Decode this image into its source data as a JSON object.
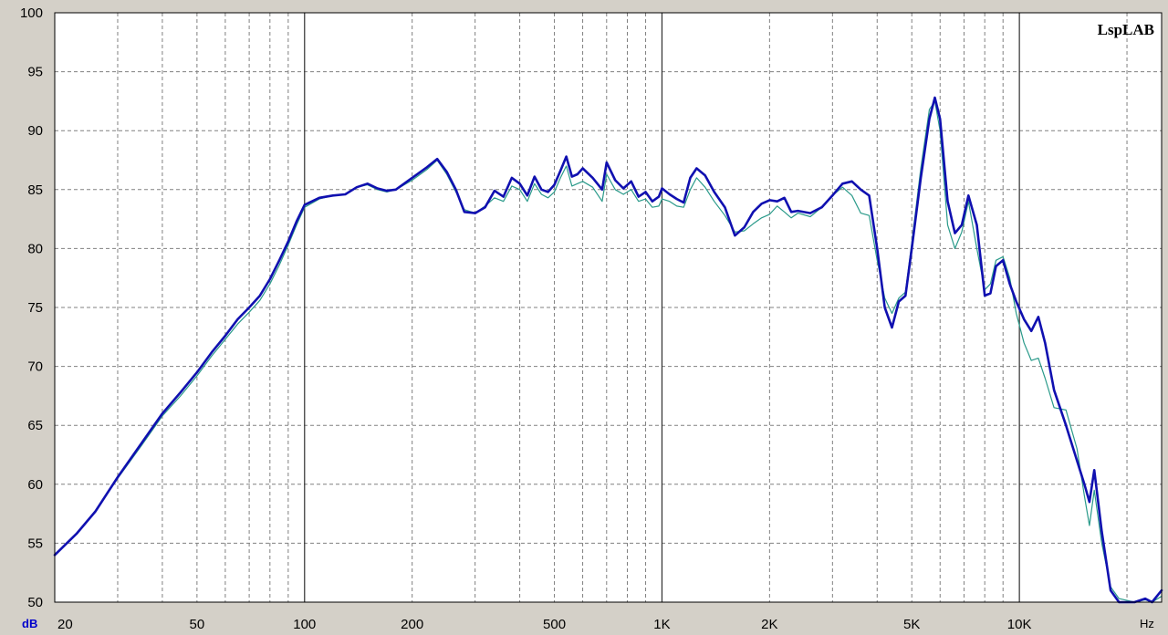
{
  "chart_data": {
    "type": "line",
    "title": "",
    "brand": "LspLAB",
    "xlabel": "Hz",
    "ylabel": "dB",
    "x_scale": "log",
    "xlim": [
      20,
      25000
    ],
    "ylim": [
      50,
      100
    ],
    "x_tick_labels": [
      {
        "value": 20,
        "label": "20"
      },
      {
        "value": 50,
        "label": "50"
      },
      {
        "value": 100,
        "label": "100"
      },
      {
        "value": 200,
        "label": "200"
      },
      {
        "value": 500,
        "label": "500"
      },
      {
        "value": 1000,
        "label": "1K"
      },
      {
        "value": 2000,
        "label": "2K"
      },
      {
        "value": 5000,
        "label": "5K"
      },
      {
        "value": 10000,
        "label": "10K"
      }
    ],
    "y_ticks": [
      50,
      55,
      60,
      65,
      70,
      75,
      80,
      85,
      90,
      95,
      100
    ],
    "grid": true,
    "legend": "none",
    "colors": {
      "plot_background": "#ffffff",
      "window_background": "#d4d0c8",
      "grid": "#808080",
      "axis_label": "#0000cc",
      "series_primary": "#1010b0",
      "series_secondary": "#2a9a8a"
    },
    "series": [
      {
        "color": "#1010b0",
        "points": [
          [
            20,
            54.0
          ],
          [
            23,
            55.8
          ],
          [
            26,
            57.7
          ],
          [
            30,
            60.6
          ],
          [
            35,
            63.5
          ],
          [
            40,
            66.0
          ],
          [
            45,
            67.8
          ],
          [
            50,
            69.5
          ],
          [
            55,
            71.2
          ],
          [
            60,
            72.6
          ],
          [
            65,
            74.0
          ],
          [
            70,
            75.0
          ],
          [
            75,
            76.0
          ],
          [
            80,
            77.4
          ],
          [
            85,
            79.0
          ],
          [
            90,
            80.6
          ],
          [
            95,
            82.3
          ],
          [
            100,
            83.7
          ],
          [
            110,
            84.3
          ],
          [
            120,
            84.5
          ],
          [
            130,
            84.6
          ],
          [
            140,
            85.2
          ],
          [
            150,
            85.5
          ],
          [
            160,
            85.1
          ],
          [
            170,
            84.9
          ],
          [
            180,
            85.0
          ],
          [
            200,
            86.0
          ],
          [
            220,
            86.9
          ],
          [
            235,
            87.6
          ],
          [
            250,
            86.5
          ],
          [
            265,
            85.0
          ],
          [
            280,
            83.1
          ],
          [
            300,
            83.0
          ],
          [
            320,
            83.5
          ],
          [
            340,
            84.9
          ],
          [
            360,
            84.4
          ],
          [
            380,
            86.0
          ],
          [
            400,
            85.5
          ],
          [
            420,
            84.5
          ],
          [
            440,
            86.1
          ],
          [
            460,
            85.0
          ],
          [
            480,
            84.8
          ],
          [
            500,
            85.4
          ],
          [
            520,
            86.6
          ],
          [
            540,
            87.8
          ],
          [
            560,
            86.1
          ],
          [
            580,
            86.3
          ],
          [
            600,
            86.8
          ],
          [
            640,
            86.0
          ],
          [
            680,
            85.0
          ],
          [
            700,
            87.3
          ],
          [
            740,
            85.8
          ],
          [
            780,
            85.1
          ],
          [
            820,
            85.7
          ],
          [
            860,
            84.4
          ],
          [
            900,
            84.8
          ],
          [
            940,
            84.0
          ],
          [
            980,
            84.4
          ],
          [
            1000,
            85.1
          ],
          [
            1050,
            84.6
          ],
          [
            1100,
            84.2
          ],
          [
            1150,
            83.9
          ],
          [
            1200,
            86.0
          ],
          [
            1250,
            86.8
          ],
          [
            1320,
            86.2
          ],
          [
            1400,
            84.8
          ],
          [
            1500,
            83.5
          ],
          [
            1600,
            81.1
          ],
          [
            1700,
            81.8
          ],
          [
            1800,
            83.1
          ],
          [
            1900,
            83.8
          ],
          [
            2000,
            84.1
          ],
          [
            2100,
            84.0
          ],
          [
            2200,
            84.3
          ],
          [
            2300,
            83.1
          ],
          [
            2400,
            83.2
          ],
          [
            2600,
            83.0
          ],
          [
            2800,
            83.5
          ],
          [
            3000,
            84.5
          ],
          [
            3200,
            85.5
          ],
          [
            3400,
            85.7
          ],
          [
            3600,
            85.0
          ],
          [
            3800,
            84.5
          ],
          [
            4000,
            80.0
          ],
          [
            4200,
            75.0
          ],
          [
            4400,
            73.3
          ],
          [
            4600,
            75.5
          ],
          [
            4800,
            76.0
          ],
          [
            5000,
            80.0
          ],
          [
            5300,
            86.0
          ],
          [
            5600,
            91.0
          ],
          [
            5800,
            92.8
          ],
          [
            6000,
            91.0
          ],
          [
            6300,
            84.0
          ],
          [
            6600,
            81.3
          ],
          [
            6900,
            82.0
          ],
          [
            7200,
            84.5
          ],
          [
            7600,
            82.0
          ],
          [
            8000,
            76.0
          ],
          [
            8300,
            76.2
          ],
          [
            8600,
            78.5
          ],
          [
            9000,
            79.0
          ],
          [
            9400,
            77.0
          ],
          [
            9800,
            75.5
          ],
          [
            10300,
            74.0
          ],
          [
            10800,
            73.0
          ],
          [
            11300,
            74.2
          ],
          [
            11800,
            72.0
          ],
          [
            12500,
            68.0
          ],
          [
            13500,
            65.0
          ],
          [
            14500,
            62.0
          ],
          [
            15200,
            60.0
          ],
          [
            15700,
            58.5
          ],
          [
            16200,
            61.2
          ],
          [
            17000,
            56.0
          ],
          [
            18000,
            51.0
          ],
          [
            19000,
            50.0
          ],
          [
            21000,
            50.0
          ],
          [
            22500,
            50.3
          ],
          [
            23500,
            50.0
          ],
          [
            25000,
            51.0
          ]
        ]
      },
      {
        "color": "#2a9a8a",
        "points": [
          [
            20,
            54.0
          ],
          [
            23,
            55.8
          ],
          [
            26,
            57.7
          ],
          [
            30,
            60.5
          ],
          [
            35,
            63.3
          ],
          [
            40,
            65.8
          ],
          [
            45,
            67.5
          ],
          [
            50,
            69.2
          ],
          [
            55,
            70.9
          ],
          [
            60,
            72.3
          ],
          [
            65,
            73.6
          ],
          [
            70,
            74.6
          ],
          [
            75,
            75.6
          ],
          [
            80,
            77.0
          ],
          [
            85,
            78.6
          ],
          [
            90,
            80.3
          ],
          [
            95,
            82.0
          ],
          [
            100,
            83.5
          ],
          [
            110,
            84.2
          ],
          [
            120,
            84.5
          ],
          [
            130,
            84.6
          ],
          [
            140,
            85.2
          ],
          [
            150,
            85.4
          ],
          [
            160,
            85.0
          ],
          [
            170,
            84.8
          ],
          [
            180,
            85.0
          ],
          [
            200,
            85.8
          ],
          [
            220,
            86.7
          ],
          [
            235,
            87.5
          ],
          [
            250,
            86.3
          ],
          [
            265,
            84.8
          ],
          [
            280,
            83.3
          ],
          [
            300,
            83.0
          ],
          [
            320,
            83.6
          ],
          [
            340,
            84.3
          ],
          [
            360,
            84.0
          ],
          [
            380,
            85.3
          ],
          [
            400,
            85.0
          ],
          [
            420,
            84.0
          ],
          [
            440,
            85.5
          ],
          [
            460,
            84.6
          ],
          [
            480,
            84.3
          ],
          [
            500,
            84.8
          ],
          [
            520,
            86.0
          ],
          [
            540,
            87.0
          ],
          [
            560,
            85.3
          ],
          [
            580,
            85.5
          ],
          [
            600,
            85.7
          ],
          [
            640,
            85.2
          ],
          [
            680,
            84.0
          ],
          [
            700,
            86.3
          ],
          [
            740,
            85.0
          ],
          [
            780,
            84.6
          ],
          [
            820,
            85.0
          ],
          [
            860,
            84.0
          ],
          [
            900,
            84.2
          ],
          [
            940,
            83.5
          ],
          [
            980,
            83.6
          ],
          [
            1000,
            84.2
          ],
          [
            1050,
            84.0
          ],
          [
            1100,
            83.6
          ],
          [
            1150,
            83.5
          ],
          [
            1200,
            85.0
          ],
          [
            1250,
            86.0
          ],
          [
            1320,
            85.2
          ],
          [
            1400,
            84.0
          ],
          [
            1500,
            82.8
          ],
          [
            1600,
            81.4
          ],
          [
            1700,
            81.5
          ],
          [
            1800,
            82.1
          ],
          [
            1900,
            82.6
          ],
          [
            2000,
            82.9
          ],
          [
            2100,
            83.6
          ],
          [
            2200,
            83.1
          ],
          [
            2300,
            82.6
          ],
          [
            2400,
            83.0
          ],
          [
            2600,
            82.7
          ],
          [
            2800,
            83.5
          ],
          [
            3000,
            84.5
          ],
          [
            3200,
            85.2
          ],
          [
            3400,
            84.5
          ],
          [
            3600,
            83.0
          ],
          [
            3800,
            82.8
          ],
          [
            4000,
            79.0
          ],
          [
            4200,
            75.8
          ],
          [
            4400,
            74.5
          ],
          [
            4600,
            75.8
          ],
          [
            4800,
            76.3
          ],
          [
            5000,
            80.5
          ],
          [
            5300,
            86.8
          ],
          [
            5600,
            91.8
          ],
          [
            5800,
            92.5
          ],
          [
            6000,
            90.0
          ],
          [
            6300,
            82.0
          ],
          [
            6600,
            80.0
          ],
          [
            6900,
            81.4
          ],
          [
            7200,
            84.0
          ],
          [
            7600,
            80.0
          ],
          [
            8000,
            76.5
          ],
          [
            8300,
            77.0
          ],
          [
            8600,
            79.0
          ],
          [
            9000,
            79.3
          ],
          [
            9400,
            77.5
          ],
          [
            9800,
            74.5
          ],
          [
            10300,
            72.0
          ],
          [
            10800,
            70.5
          ],
          [
            11300,
            70.7
          ],
          [
            11800,
            69.0
          ],
          [
            12500,
            66.5
          ],
          [
            13500,
            66.3
          ],
          [
            14500,
            63.0
          ],
          [
            15200,
            59.0
          ],
          [
            15700,
            56.5
          ],
          [
            16200,
            59.5
          ],
          [
            17000,
            55.0
          ],
          [
            18000,
            51.3
          ],
          [
            19000,
            50.3
          ],
          [
            21000,
            50.0
          ],
          [
            22500,
            50.2
          ],
          [
            23500,
            50.0
          ],
          [
            25000,
            50.5
          ]
        ]
      }
    ]
  }
}
